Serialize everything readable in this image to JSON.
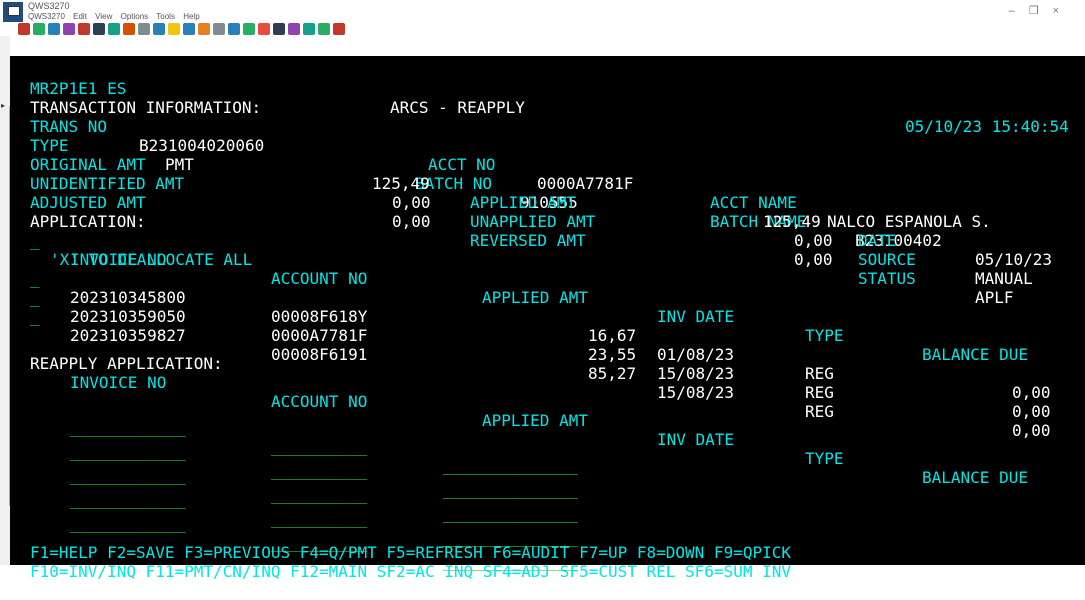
{
  "window": {
    "title": "QWS3270",
    "menu": [
      "QWS3270",
      "Edit",
      "View",
      "Options",
      "Tools",
      "Help"
    ],
    "controls": [
      "–",
      "❐",
      "×"
    ]
  },
  "toolbar_colors": [
    "#c0392b",
    "#27ae60",
    "#2980b9",
    "#8e44ad",
    "#c0392b",
    "#2c3e50",
    "#16a085",
    "#d35400",
    "#7f8c8d",
    "#2980b9",
    "#f1c40f",
    "#2980b9",
    "#e67e22",
    "#7f8c8d",
    "#2980b9",
    "#27ae60",
    "#e74c3c",
    "#2c3e50",
    "#8e44ad",
    "#16a085",
    "#27ae60",
    "#c0392b"
  ],
  "screen": {
    "program_id": "MR2P1E1 ES",
    "screen_title": "ARCS - REAPPLY",
    "datetime": "05/10/23 15:40:54",
    "section_transaction": "TRANSACTION INFORMATION:",
    "trans_no_label": "TRANS NO",
    "trans_no": "B231004020060",
    "acct_no_label": "ACCT NO",
    "acct_no": "0000A7781F",
    "acct_name_label": "ACCT NAME",
    "acct_name": "NALCO ESPANOLA S.",
    "type_label": "TYPE",
    "type": "PMT",
    "batch_no_label": "BATCH NO",
    "batch_no": "910555",
    "batch_name_label": "BATCH NAME",
    "batch_name": "B23100402",
    "original_amt_label": "ORIGINAL AMT",
    "original_amt": "125,49",
    "applied_amt_label": "APPLIED AMT",
    "applied_amt": "125,49",
    "date_label": "DATE",
    "date": "05/10/23",
    "unidentified_amt_label": "UNIDENTIFIED AMT",
    "unidentified_amt": "0,00",
    "unapplied_amt_label": "UNAPPLIED AMT",
    "unapplied_amt": "0,00",
    "source_label": "SOURCE",
    "source": "MANUAL",
    "adjusted_amt_label": "ADJUSTED AMT",
    "adjusted_amt": "0,00",
    "reversed_amt_label": "REVERSED AMT",
    "reversed_amt": "0,00",
    "status_label": "STATUS",
    "status": "APLF",
    "section_application": "APPLICATION:",
    "dealloc_marker": "_",
    "dealloc_text": "'X' TO DEALLOCATE ALL",
    "columns": {
      "invoice_no": "INVOICE NO",
      "account_no": "ACCOUNT NO",
      "applied_amt": "APPLIED AMT",
      "inv_date": "INV DATE",
      "type": "TYPE",
      "balance_due": "BALANCE DUE"
    },
    "applications": [
      {
        "sel": "_",
        "invoice": "202310345800",
        "account": "00008F618Y",
        "amount": "16,67",
        "date": "01/08/23",
        "type": "REG",
        "balance": "0,00"
      },
      {
        "sel": "_",
        "invoice": "202310359050",
        "account": "0000A7781F",
        "amount": "23,55",
        "date": "15/08/23",
        "type": "REG",
        "balance": "0,00"
      },
      {
        "sel": "_",
        "invoice": "202310359827",
        "account": "00008F6191",
        "amount": "85,27",
        "date": "15/08/23",
        "type": "REG",
        "balance": "0,00"
      }
    ],
    "section_reapply": "REAPPLY APPLICATION:",
    "reapply_inputs": {
      "invoice": "____________",
      "account": "__________",
      "amount": "______________"
    },
    "fkeys_line1": "F1=HELP F2=SAVE F3=PREVIOUS F4=Q/PMT F5=REFRESH F6=AUDIT F7=UP F8=DOWN F9=QPICK",
    "fkeys_line2": "F10=INV/INQ F11=PMT/CN/INQ F12=MAIN SF2=AC INQ SF4=ADJ SF5=CUST REL SF6=SUM INV"
  }
}
